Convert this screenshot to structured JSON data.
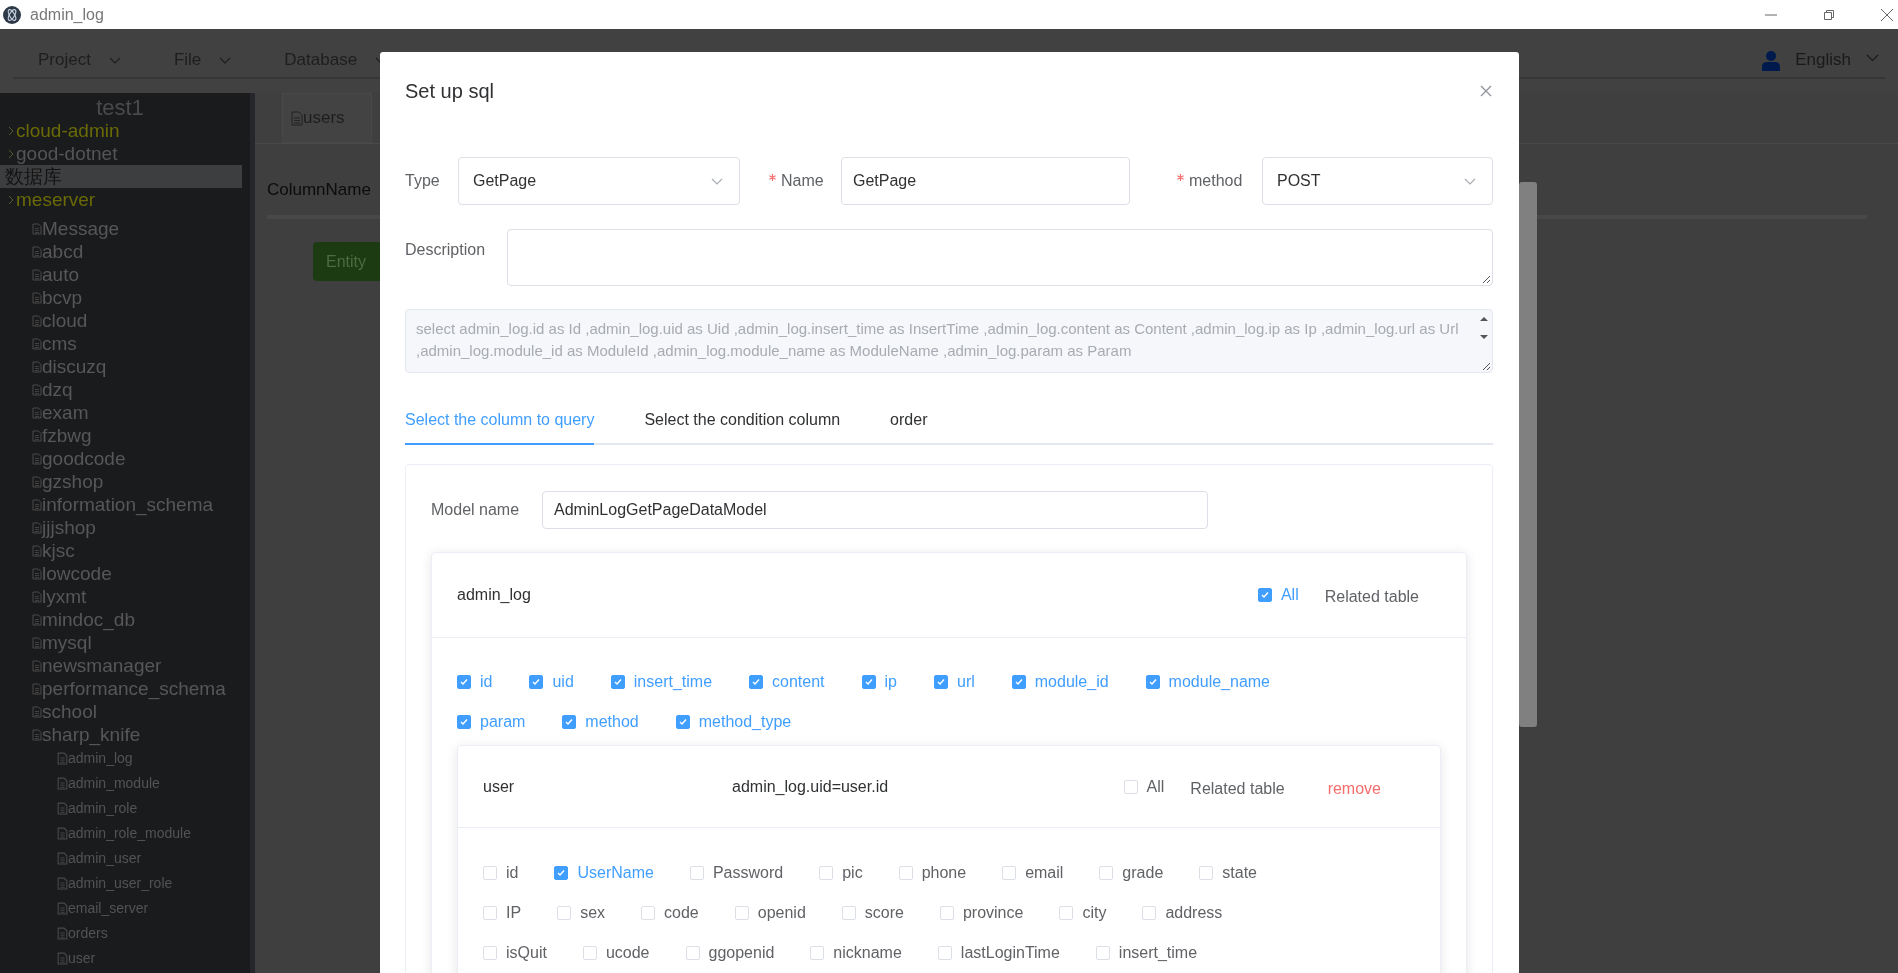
{
  "window": {
    "title": "admin_log"
  },
  "menu": [
    {
      "label": "Project"
    },
    {
      "label": "File"
    },
    {
      "label": "Database"
    }
  ],
  "language": "English",
  "tree": {
    "title": "test1",
    "items": [
      {
        "label": "cloud-admin",
        "kind": "connection",
        "highlighted": true,
        "selected": false
      },
      {
        "label": "good-dotnet",
        "kind": "connection",
        "highlighted": false,
        "selected": false
      },
      {
        "label": "数据库",
        "kind": "label",
        "highlighted": false,
        "selected": true
      },
      {
        "label": "meserver",
        "kind": "connection",
        "highlighted": true,
        "selected": false,
        "children": [
          {
            "label": "Message",
            "kind": "database"
          },
          {
            "label": "abcd",
            "kind": "database"
          },
          {
            "label": "auto",
            "kind": "database"
          },
          {
            "label": "bcvp",
            "kind": "database"
          },
          {
            "label": "cloud",
            "kind": "database"
          },
          {
            "label": "cms",
            "kind": "database"
          },
          {
            "label": "discuzq",
            "kind": "database"
          },
          {
            "label": "dzq",
            "kind": "database"
          },
          {
            "label": "exam",
            "kind": "database"
          },
          {
            "label": "fzbwg",
            "kind": "database"
          },
          {
            "label": "goodcode",
            "kind": "database"
          },
          {
            "label": "gzshop",
            "kind": "database"
          },
          {
            "label": "information_schema",
            "kind": "database"
          },
          {
            "label": "jjjshop",
            "kind": "database"
          },
          {
            "label": "kjsc",
            "kind": "database"
          },
          {
            "label": "lowcode",
            "kind": "database"
          },
          {
            "label": "lyxmt",
            "kind": "database"
          },
          {
            "label": "mindoc_db",
            "kind": "database"
          },
          {
            "label": "mysql",
            "kind": "database"
          },
          {
            "label": "newsmanager",
            "kind": "database"
          },
          {
            "label": "performance_schema",
            "kind": "database"
          },
          {
            "label": "school",
            "kind": "database"
          },
          {
            "label": "sharp_knife",
            "kind": "database",
            "children": [
              {
                "label": "admin_log",
                "kind": "table"
              },
              {
                "label": "admin_module",
                "kind": "table"
              },
              {
                "label": "admin_role",
                "kind": "table"
              },
              {
                "label": "admin_role_module",
                "kind": "table"
              },
              {
                "label": "admin_user",
                "kind": "table"
              },
              {
                "label": "admin_user_role",
                "kind": "table"
              },
              {
                "label": "email_server",
                "kind": "table"
              },
              {
                "label": "orders",
                "kind": "table"
              },
              {
                "label": "user",
                "kind": "table"
              }
            ]
          }
        ]
      }
    ]
  },
  "content_tab": {
    "label": "users"
  },
  "column_header": "ColumnName",
  "entity_button": "Entity",
  "dialog": {
    "title": "Set up sql",
    "fields": [
      {
        "label": "Type",
        "required": false,
        "value": "GetPage",
        "kind": "select"
      },
      {
        "label": "Name",
        "required": true,
        "value": "GetPage",
        "kind": "input"
      },
      {
        "label": "method",
        "required": true,
        "value": "POST",
        "kind": "select"
      }
    ],
    "description": {
      "label": "Description"
    },
    "sql": "select admin_log.id as Id ,admin_log.uid as Uid ,admin_log.insert_time as InsertTime ,admin_log.content as Content ,admin_log.ip as Ip ,admin_log.url as Url ,admin_log.module_id as ModuleId ,admin_log.module_name as ModuleName ,admin_log.param as Param",
    "tabs": [
      {
        "label": "Select the column to query",
        "selected": true
      },
      {
        "label": "Select the condition column",
        "selected": false
      },
      {
        "label": "order",
        "selected": false
      }
    ],
    "model_name": {
      "label": "Model name",
      "value": "AdminLogGetPageDataModel"
    },
    "table": {
      "name": "admin_log",
      "all": {
        "label": "All",
        "checked": true
      },
      "related": "Related table",
      "columns": [
        {
          "label": "id",
          "checked": true
        },
        {
          "label": "uid",
          "checked": true
        },
        {
          "label": "insert_time",
          "checked": true
        },
        {
          "label": "content",
          "checked": true
        },
        {
          "label": "ip",
          "checked": true
        },
        {
          "label": "url",
          "checked": true
        },
        {
          "label": "module_id",
          "checked": true
        },
        {
          "label": "module_name",
          "checked": true
        },
        {
          "label": "param",
          "checked": true
        },
        {
          "label": "method",
          "checked": true
        },
        {
          "label": "method_type",
          "checked": true
        }
      ],
      "joins": [
        {
          "name": "user",
          "condition": "admin_log.uid=user.id",
          "all": {
            "label": "All",
            "checked": false
          },
          "related": "Related table",
          "remove": "remove",
          "columns": [
            {
              "label": "id",
              "checked": false
            },
            {
              "label": "UserName",
              "checked": true
            },
            {
              "label": "Password",
              "checked": false
            },
            {
              "label": "pic",
              "checked": false
            },
            {
              "label": "phone",
              "checked": false
            },
            {
              "label": "email",
              "checked": false
            },
            {
              "label": "grade",
              "checked": false
            },
            {
              "label": "state",
              "checked": false
            },
            {
              "label": "IP",
              "checked": false
            },
            {
              "label": "sex",
              "checked": false
            },
            {
              "label": "code",
              "checked": false
            },
            {
              "label": "openid",
              "checked": false
            },
            {
              "label": "score",
              "checked": false
            },
            {
              "label": "province",
              "checked": false
            },
            {
              "label": "city",
              "checked": false
            },
            {
              "label": "address",
              "checked": false
            },
            {
              "label": "isQuit",
              "checked": false
            },
            {
              "label": "ucode",
              "checked": false
            },
            {
              "label": "ggopenid",
              "checked": false
            },
            {
              "label": "nickname",
              "checked": false
            },
            {
              "label": "lastLoginTime",
              "checked": false
            },
            {
              "label": "insert_time",
              "checked": false
            }
          ]
        }
      ]
    }
  }
}
